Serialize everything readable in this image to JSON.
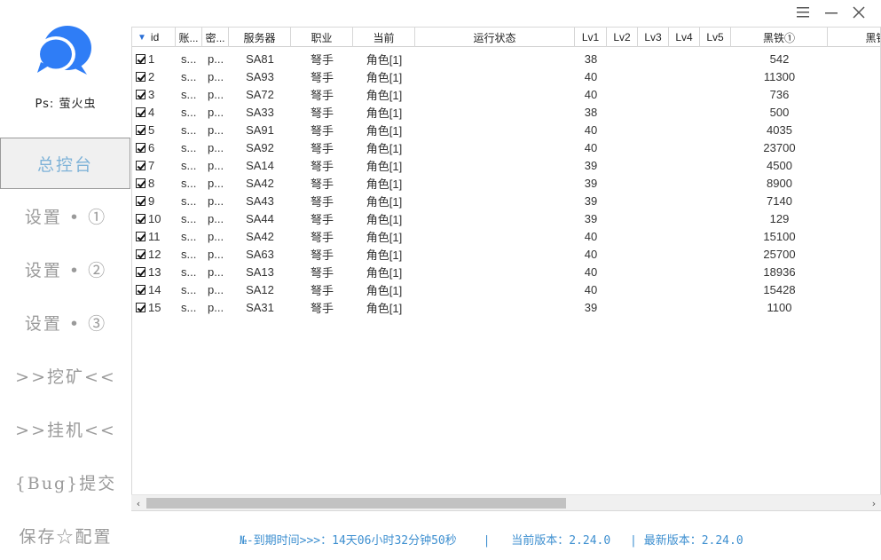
{
  "window": {
    "menu_icon": "hamburger-icon",
    "min_icon": "minimize-icon",
    "close_icon": "close-icon"
  },
  "brand": {
    "name": "Ps: 萤火虫",
    "logo_color": "#2f7df6"
  },
  "sidebar": {
    "items": [
      {
        "label": "总控台",
        "active": true
      },
      {
        "label": "设置 • ①",
        "active": false
      },
      {
        "label": "设置 • ②",
        "active": false
      },
      {
        "label": "设置 • ③",
        "active": false
      },
      {
        "label": ">>挖矿<<",
        "active": false
      },
      {
        "label": ">>挂机<<",
        "active": false
      },
      {
        "label": "{Bug}提交",
        "active": false
      },
      {
        "label": "保存☆配置",
        "active": false
      }
    ]
  },
  "table": {
    "columns": [
      "id",
      "账...",
      "密...",
      "服务器",
      "职业",
      "当前",
      "运行状态",
      "Lv1",
      "Lv2",
      "Lv3",
      "Lv4",
      "Lv5",
      "黑铁①",
      "黑铁"
    ],
    "sort_icon": "sort-desc-icon",
    "rows": [
      {
        "checked": true,
        "id": "1",
        "account": "s...",
        "password": "p...",
        "server": "SA81",
        "job": "弩手",
        "current": "角色[1]",
        "status": "",
        "lv1": "38",
        "lv2": "",
        "lv3": "",
        "lv4": "",
        "lv5": "",
        "iron": "542"
      },
      {
        "checked": true,
        "id": "2",
        "account": "s...",
        "password": "p...",
        "server": "SA93",
        "job": "弩手",
        "current": "角色[1]",
        "status": "",
        "lv1": "40",
        "lv2": "",
        "lv3": "",
        "lv4": "",
        "lv5": "",
        "iron": "11300"
      },
      {
        "checked": true,
        "id": "3",
        "account": "s...",
        "password": "p...",
        "server": "SA72",
        "job": "弩手",
        "current": "角色[1]",
        "status": "",
        "lv1": "40",
        "lv2": "",
        "lv3": "",
        "lv4": "",
        "lv5": "",
        "iron": "736"
      },
      {
        "checked": true,
        "id": "4",
        "account": "s...",
        "password": "p...",
        "server": "SA33",
        "job": "弩手",
        "current": "角色[1]",
        "status": "",
        "lv1": "38",
        "lv2": "",
        "lv3": "",
        "lv4": "",
        "lv5": "",
        "iron": "500"
      },
      {
        "checked": true,
        "id": "5",
        "account": "s...",
        "password": "p...",
        "server": "SA91",
        "job": "弩手",
        "current": "角色[1]",
        "status": "",
        "lv1": "40",
        "lv2": "",
        "lv3": "",
        "lv4": "",
        "lv5": "",
        "iron": "4035"
      },
      {
        "checked": true,
        "id": "6",
        "account": "s...",
        "password": "p...",
        "server": "SA92",
        "job": "弩手",
        "current": "角色[1]",
        "status": "",
        "lv1": "40",
        "lv2": "",
        "lv3": "",
        "lv4": "",
        "lv5": "",
        "iron": "23700"
      },
      {
        "checked": true,
        "id": "7",
        "account": "s...",
        "password": "p...",
        "server": "SA14",
        "job": "弩手",
        "current": "角色[1]",
        "status": "",
        "lv1": "39",
        "lv2": "",
        "lv3": "",
        "lv4": "",
        "lv5": "",
        "iron": "4500"
      },
      {
        "checked": true,
        "id": "8",
        "account": "s...",
        "password": "p...",
        "server": "SA42",
        "job": "弩手",
        "current": "角色[1]",
        "status": "",
        "lv1": "39",
        "lv2": "",
        "lv3": "",
        "lv4": "",
        "lv5": "",
        "iron": "8900"
      },
      {
        "checked": true,
        "id": "9",
        "account": "s...",
        "password": "p...",
        "server": "SA43",
        "job": "弩手",
        "current": "角色[1]",
        "status": "",
        "lv1": "39",
        "lv2": "",
        "lv3": "",
        "lv4": "",
        "lv5": "",
        "iron": "7140"
      },
      {
        "checked": true,
        "id": "10",
        "account": "s...",
        "password": "p...",
        "server": "SA44",
        "job": "弩手",
        "current": "角色[1]",
        "status": "",
        "lv1": "39",
        "lv2": "",
        "lv3": "",
        "lv4": "",
        "lv5": "",
        "iron": "129"
      },
      {
        "checked": true,
        "id": "11",
        "account": "s...",
        "password": "p...",
        "server": "SA42",
        "job": "弩手",
        "current": "角色[1]",
        "status": "",
        "lv1": "40",
        "lv2": "",
        "lv3": "",
        "lv4": "",
        "lv5": "",
        "iron": "15100"
      },
      {
        "checked": true,
        "id": "12",
        "account": "s...",
        "password": "p...",
        "server": "SA63",
        "job": "弩手",
        "current": "角色[1]",
        "status": "",
        "lv1": "40",
        "lv2": "",
        "lv3": "",
        "lv4": "",
        "lv5": "",
        "iron": "25700"
      },
      {
        "checked": true,
        "id": "13",
        "account": "s...",
        "password": "p...",
        "server": "SA13",
        "job": "弩手",
        "current": "角色[1]",
        "status": "",
        "lv1": "40",
        "lv2": "",
        "lv3": "",
        "lv4": "",
        "lv5": "",
        "iron": "18936"
      },
      {
        "checked": true,
        "id": "14",
        "account": "s...",
        "password": "p...",
        "server": "SA12",
        "job": "弩手",
        "current": "角色[1]",
        "status": "",
        "lv1": "40",
        "lv2": "",
        "lv3": "",
        "lv4": "",
        "lv5": "",
        "iron": "15428"
      },
      {
        "checked": true,
        "id": "15",
        "account": "s...",
        "password": "p...",
        "server": "SA31",
        "job": "弩手",
        "current": "角色[1]",
        "status": "",
        "lv1": "39",
        "lv2": "",
        "lv3": "",
        "lv4": "",
        "lv5": "",
        "iron": "1100"
      }
    ]
  },
  "scrollbar": {
    "left_icon": "chevron-left-icon",
    "right_icon": "chevron-right-icon"
  },
  "footer": {
    "expiry": "№-到期时间>>>：14天06小时32分钟50秒",
    "sep1": "|",
    "current_version": "当前版本：2.24.0",
    "sep2": "|",
    "latest_version": "最新版本：2.24.0",
    "color": "#3d8fd0"
  }
}
